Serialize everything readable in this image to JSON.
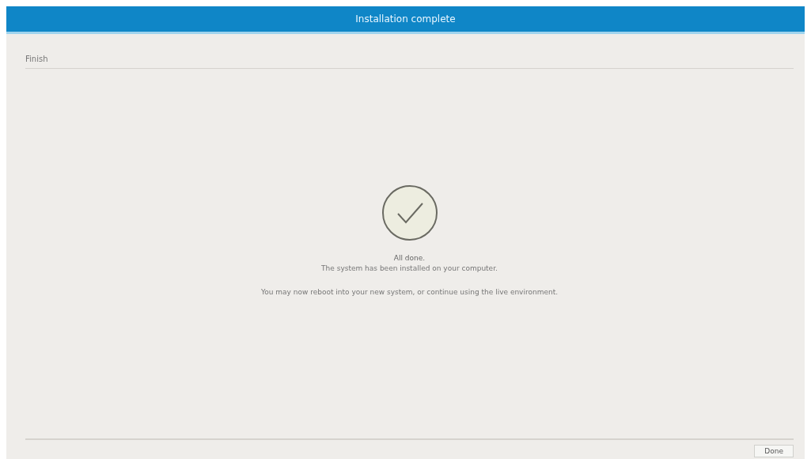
{
  "window": {
    "title": "Installation complete"
  },
  "header": {
    "step": "Finish"
  },
  "result": {
    "kind": "success",
    "heading": "All done.",
    "subheading": "The system has been installed on your computer.",
    "note": "You may now reboot into your new system, or continue using the live environment."
  },
  "buttons": [
    {
      "label": "Done"
    }
  ]
}
